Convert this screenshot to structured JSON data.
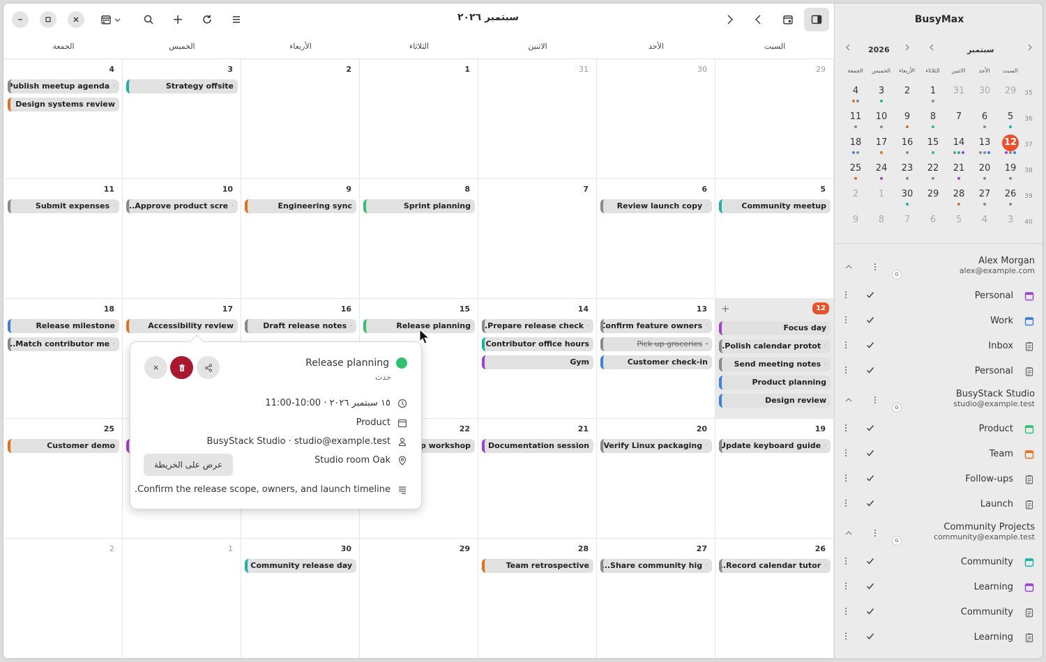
{
  "app": {
    "title": "BusyMax"
  },
  "header": {
    "month_title": "سبتمبر ٢٠٢٦"
  },
  "weekdays": [
    "السبت",
    "الأحد",
    "الاثنين",
    "الثلاثاء",
    "الأربعاء",
    "الخميس",
    "الجمعة"
  ],
  "colors": {
    "today": "#e8512a",
    "orange": "#e0701c",
    "teal": "#1ab3a6",
    "green": "#30c070",
    "blue": "#3b7fe0",
    "purple": "#a040d0",
    "gray": "#888888",
    "dark_red": "#a8182e"
  },
  "weeks": [
    {
      "days": [
        {
          "n": "29",
          "dim": true,
          "events": []
        },
        {
          "n": "30",
          "dim": true,
          "events": []
        },
        {
          "n": "31",
          "dim": true,
          "events": []
        },
        {
          "n": "1",
          "events": []
        },
        {
          "n": "2",
          "events": []
        },
        {
          "n": "3",
          "events": [
            {
              "t": "Strategy offsite",
              "c": "teal"
            }
          ]
        },
        {
          "n": "4",
          "events": [
            {
              "t": "Publish meetup agenda",
              "c": "gray",
              "dot": true
            },
            {
              "t": "Design systems review",
              "c": "orange"
            }
          ]
        }
      ]
    },
    {
      "days": [
        {
          "n": "5",
          "events": [
            {
              "t": "Community meetup",
              "c": "teal"
            }
          ]
        },
        {
          "n": "6",
          "events": [
            {
              "t": "Review launch copy",
              "c": "gray",
              "dot": true
            }
          ]
        },
        {
          "n": "7",
          "events": []
        },
        {
          "n": "8",
          "events": [
            {
              "t": "Sprint planning",
              "c": "green"
            }
          ]
        },
        {
          "n": "9",
          "events": [
            {
              "t": "Engineering sync",
              "c": "orange"
            }
          ]
        },
        {
          "n": "10",
          "events": [
            {
              "t": "...Approve product scre",
              "c": "gray",
              "dot": true
            }
          ]
        },
        {
          "n": "11",
          "events": [
            {
              "t": "Submit expenses",
              "c": "gray",
              "dot": true
            }
          ]
        }
      ]
    },
    {
      "days": [
        {
          "n": "12",
          "today": true,
          "events": [
            {
              "t": "Focus day",
              "c": "purple"
            },
            {
              "t": "...Polish calendar protot",
              "c": "gray",
              "dot": true
            },
            {
              "t": "Send meeting notes",
              "c": "gray",
              "dot": true
            },
            {
              "t": "Product planning",
              "c": "blue"
            },
            {
              "t": "Design review",
              "c": "blue"
            }
          ]
        },
        {
          "n": "13",
          "events": [
            {
              "t": "Confirm feature owners",
              "c": "gray",
              "dot": true
            },
            {
              "t": "Pick up groceries",
              "c": "gray",
              "dot": true,
              "strike": true
            },
            {
              "t": "Customer check-in",
              "c": "blue"
            }
          ]
        },
        {
          "n": "14",
          "events": [
            {
              "t": "...Prepare release check",
              "c": "gray",
              "dot": true
            },
            {
              "t": "Contributor office hours",
              "c": "teal"
            },
            {
              "t": "Gym",
              "c": "purple"
            }
          ]
        },
        {
          "n": "15",
          "events": [
            {
              "t": "Release planning",
              "c": "green"
            }
          ]
        },
        {
          "n": "16",
          "events": [
            {
              "t": "Draft release notes",
              "c": "gray",
              "dot": true
            }
          ]
        },
        {
          "n": "17",
          "events": [
            {
              "t": "Accessibility review",
              "c": "orange"
            }
          ]
        },
        {
          "n": "18",
          "events": [
            {
              "t": "Release milestone",
              "c": "blue"
            },
            {
              "t": "...Match contributor me",
              "c": "gray",
              "dot": true
            }
          ]
        }
      ]
    },
    {
      "days": [
        {
          "n": "19",
          "events": [
            {
              "t": "Update keyboard guide",
              "c": "gray",
              "dot": true
            }
          ]
        },
        {
          "n": "20",
          "events": [
            {
              "t": "Verify Linux packaging",
              "c": "gray",
              "dot": true
            }
          ]
        },
        {
          "n": "21",
          "events": [
            {
              "t": "Documentation session",
              "c": "purple"
            }
          ]
        },
        {
          "n": "22",
          "events": [
            {
              "t": "Roadmap workshop",
              "c": "gray"
            }
          ]
        },
        {
          "n": "23",
          "events": []
        },
        {
          "n": "24",
          "events": [
            {
              "t": "",
              "c": "purple"
            }
          ]
        },
        {
          "n": "25",
          "events": [
            {
              "t": "Customer demo",
              "c": "orange"
            }
          ]
        }
      ]
    },
    {
      "days": [
        {
          "n": "26",
          "events": [
            {
              "t": "...Record calendar tutor",
              "c": "gray",
              "dot": true
            }
          ]
        },
        {
          "n": "27",
          "events": [
            {
              "t": "...Share community hig",
              "c": "gray",
              "dot": true
            }
          ]
        },
        {
          "n": "28",
          "events": [
            {
              "t": "Team retrospective",
              "c": "orange"
            }
          ]
        },
        {
          "n": "29",
          "events": []
        },
        {
          "n": "30",
          "events": [
            {
              "t": "Community release day",
              "c": "teal"
            }
          ]
        },
        {
          "n": "1",
          "dim": true,
          "events": []
        },
        {
          "n": "2",
          "dim": true,
          "events": []
        }
      ]
    }
  ],
  "popup": {
    "title": "Release planning",
    "subtitle": "حدث",
    "datetime": "١٥ سبتمبر ٢٠٢٦ · 10:00-11:00",
    "calendar": "Product",
    "organizer": "BusyStack Studio · studio@example.test",
    "location": "Studio room Oak",
    "map_button": "عرض على الخريطة",
    "description": ".Confirm the release scope, owners, and launch timeline"
  },
  "mini": {
    "year": "2026",
    "month": "سبتمبر",
    "weekdays": [
      "السبت",
      "الأحد",
      "الاثنين",
      "الثلاثاء",
      "الأربعاء",
      "الخميس",
      "الجمعة"
    ],
    "weeks": [
      {
        "wk": "35",
        "days": [
          {
            "n": "29",
            "dim": true
          },
          {
            "n": "30",
            "dim": true
          },
          {
            "n": "31",
            "dim": true
          },
          {
            "n": "1",
            "dots": [
              "gray"
            ]
          },
          {
            "n": "2"
          },
          {
            "n": "3",
            "dots": [
              "teal"
            ]
          },
          {
            "n": "4",
            "dots": [
              "orange",
              "gray"
            ]
          }
        ]
      },
      {
        "wk": "36",
        "days": [
          {
            "n": "5",
            "dots": [
              "teal"
            ]
          },
          {
            "n": "6",
            "dots": [
              "gray"
            ]
          },
          {
            "n": "7"
          },
          {
            "n": "8",
            "dots": [
              "green"
            ]
          },
          {
            "n": "9",
            "dots": [
              "orange"
            ]
          },
          {
            "n": "10",
            "dots": [
              "gray"
            ]
          },
          {
            "n": "11",
            "dots": [
              "gray"
            ]
          }
        ]
      },
      {
        "wk": "37",
        "days": [
          {
            "n": "12",
            "today": true,
            "dots": [
              "purple",
              "gray",
              "blue"
            ]
          },
          {
            "n": "13",
            "dots": [
              "gray",
              "gray",
              "blue"
            ]
          },
          {
            "n": "14",
            "dots": [
              "gray",
              "teal",
              "purple"
            ]
          },
          {
            "n": "15",
            "dots": [
              "green"
            ]
          },
          {
            "n": "16",
            "dots": [
              "gray"
            ]
          },
          {
            "n": "17",
            "dots": [
              "orange"
            ]
          },
          {
            "n": "18",
            "dots": [
              "blue",
              "gray"
            ]
          }
        ]
      },
      {
        "wk": "38",
        "days": [
          {
            "n": "19",
            "dots": [
              "gray"
            ]
          },
          {
            "n": "20",
            "dots": [
              "gray"
            ]
          },
          {
            "n": "21",
            "dots": [
              "purple"
            ]
          },
          {
            "n": "22",
            "dots": [
              "gray"
            ]
          },
          {
            "n": "23",
            "dots": [
              "gray"
            ]
          },
          {
            "n": "24",
            "dots": [
              "purple"
            ]
          },
          {
            "n": "25",
            "dots": [
              "orange"
            ]
          }
        ]
      },
      {
        "wk": "39",
        "days": [
          {
            "n": "26",
            "dots": [
              "gray"
            ]
          },
          {
            "n": "27",
            "dots": [
              "gray"
            ]
          },
          {
            "n": "28",
            "dots": [
              "orange"
            ]
          },
          {
            "n": "29"
          },
          {
            "n": "30",
            "dots": [
              "teal"
            ]
          },
          {
            "n": "1",
            "dim": true
          },
          {
            "n": "2",
            "dim": true
          }
        ]
      },
      {
        "wk": "40",
        "days": [
          {
            "n": "3",
            "dim": true
          },
          {
            "n": "4",
            "dim": true
          },
          {
            "n": "5",
            "dim": true
          },
          {
            "n": "6",
            "dim": true
          },
          {
            "n": "7",
            "dim": true
          },
          {
            "n": "8",
            "dim": true
          },
          {
            "n": "9",
            "dim": true
          }
        ]
      }
    ]
  },
  "accounts": [
    {
      "name": "Alex Morgan",
      "email": "alex@example.com",
      "badge": "G",
      "calendars": [
        {
          "label": "Personal",
          "color": "#a040d0",
          "type": "cal"
        },
        {
          "label": "Work",
          "color": "#3b7fe0",
          "type": "cal"
        },
        {
          "label": "Inbox",
          "color": "#666666",
          "type": "task"
        },
        {
          "label": "Personal",
          "color": "#666666",
          "type": "task"
        }
      ]
    },
    {
      "name": "BusyStack Studio",
      "email": "studio@example.test",
      "badge": "G",
      "calendars": [
        {
          "label": "Product",
          "color": "#30c070",
          "type": "cal"
        },
        {
          "label": "Team",
          "color": "#e0701c",
          "type": "cal"
        },
        {
          "label": "Follow-ups",
          "color": "#666666",
          "type": "task"
        },
        {
          "label": "Launch",
          "color": "#666666",
          "type": "task"
        }
      ]
    },
    {
      "name": "Community Projects",
      "email": "community@example.test",
      "badge": "G",
      "calendars": [
        {
          "label": "Community",
          "color": "#1ab3a6",
          "type": "cal"
        },
        {
          "label": "Learning",
          "color": "#a040d0",
          "type": "cal"
        },
        {
          "label": "Community",
          "color": "#666666",
          "type": "task"
        },
        {
          "label": "Learning",
          "color": "#666666",
          "type": "task"
        }
      ]
    }
  ]
}
